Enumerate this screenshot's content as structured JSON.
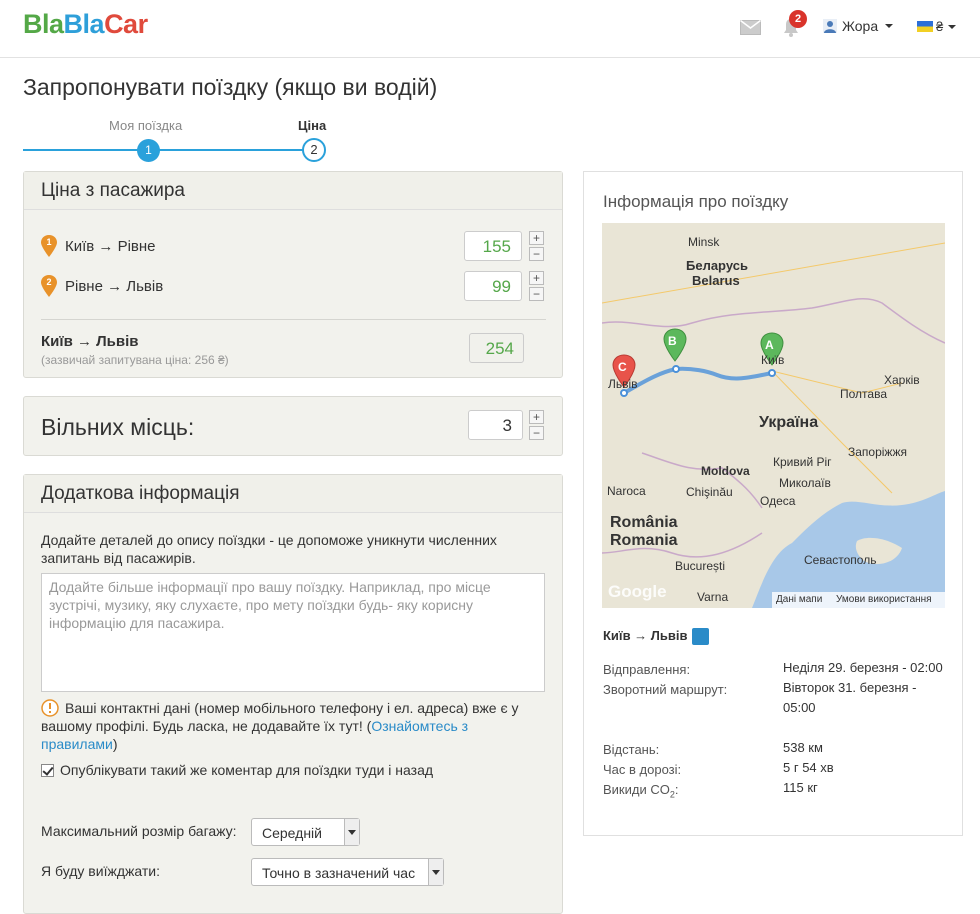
{
  "header": {
    "logo": [
      "Bla",
      "Bla",
      "Car"
    ],
    "notifications_count": "2",
    "user_name": "Жора",
    "currency": "₴"
  },
  "page_title": "Запропонувати поїздку (якщо ви водій)",
  "steps": [
    {
      "label": "Моя поїздка",
      "number": "1"
    },
    {
      "label": "Ціна",
      "number": "2"
    }
  ],
  "price": {
    "heading": "Ціна з пасажира",
    "legs": [
      {
        "route": "Київ → Рівне",
        "value": "155",
        "pin": "1"
      },
      {
        "route": "Рівне → Львів",
        "value": "99",
        "pin": "2"
      }
    ],
    "spin_plus": "+",
    "spin_minus": "−",
    "total_route": "Київ → Львів",
    "total_hint": "(зазвичай запитувана ціна: 256 ₴)",
    "total_value": "254"
  },
  "seats": {
    "label": "Вільних місць:",
    "value": "3"
  },
  "extra": {
    "heading": "Додаткова інформація",
    "description": "Додайте деталей до опису поїздки - це допоможе уникнути численних запитань від пасажирів.",
    "placeholder": "Додайте більше інформації про вашу поїздку. Наприклад, про місце зустрічі, музику, яку слухаєте, про мету поїздки будь- яку корисну інформацію для пасажира.",
    "warning": "Ваші контактні дані (номер мобільного телефону і ел. адреса) вже є у вашому профілі. Будь ласка, не додавайте їх тут! (",
    "warning_link": "Ознайомтесь з правилами",
    "warning_end": ")",
    "publish_checkbox": "Опублікувати такий же коментар для поїздки туди і назад",
    "luggage_label": "Максимальний розмір багажу:",
    "luggage_value": "Середній",
    "depart_label": "Я буду виїжджати:",
    "depart_value": "Точно в зазначений час"
  },
  "trip_info": {
    "title": "Інформація про поїздку",
    "map_labels": {
      "minsk": "Minsk",
      "belarus_ua": "Беларусь",
      "belarus": "Belarus",
      "ukraine": "Україна",
      "kyiv": "Київ",
      "lviv": "Львів",
      "kharkiv": "Харків",
      "poltava": "Полтава",
      "zaporizhzhia": "Запоріжжя",
      "kryvyi_rih": "Кривий Ріг",
      "mykolaiv": "Миколаїв",
      "odesa": "Одеса",
      "moldova": "Moldova",
      "chisinau": "Chişinău",
      "naroca": "Naroca",
      "romania1": "România",
      "romania2": "Romania",
      "bucuresti": "București",
      "varna": "Varna",
      "sevastopol": "Севастополь",
      "map_data": "Дані мапи",
      "terms": "Умови використання",
      "google": "Google",
      "marker_a": "A",
      "marker_b": "B",
      "marker_c": "C"
    },
    "route": "Київ → Львів",
    "departure_label": "Відправлення:",
    "departure_value": "Неділя 29. березня - 02:00",
    "return_label": "Зворотний маршрут:",
    "return_value": "Вівторок 31. березня - 05:00",
    "distance_label": "Відстань:",
    "distance_value": "538 км",
    "duration_label": "Час в дорозі:",
    "duration_value": "5 г 54 хв",
    "co2_label": "Викиди CO",
    "co2_sub": "2",
    "co2_colon": ":",
    "co2_value": "115 кг"
  }
}
